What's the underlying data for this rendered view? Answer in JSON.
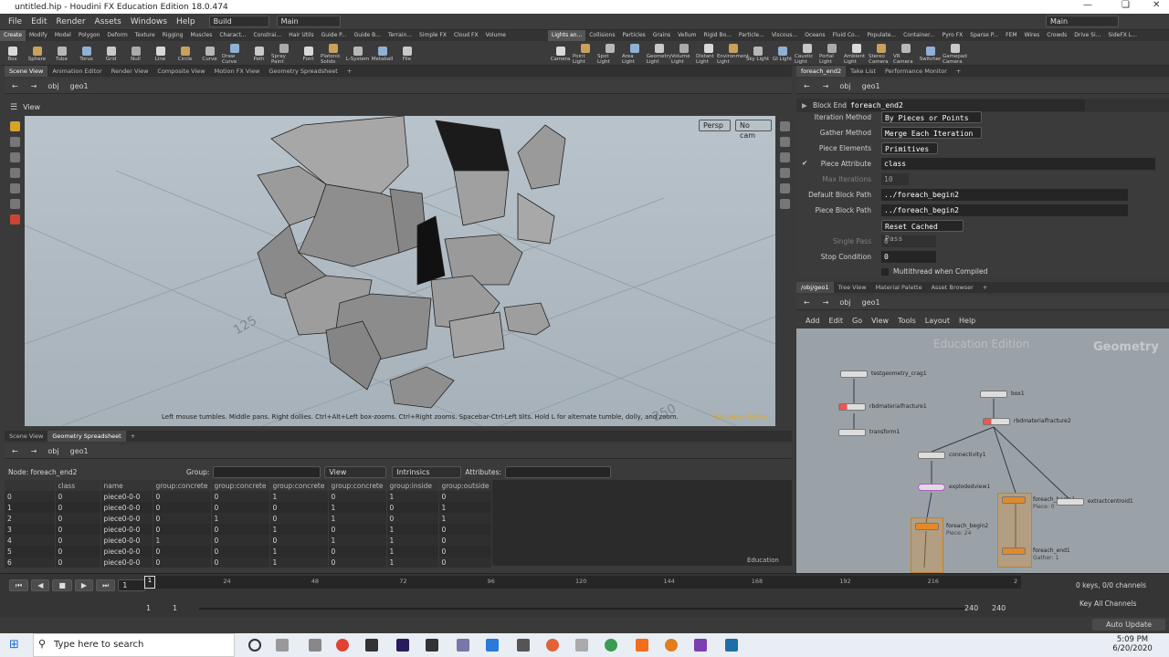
{
  "window": {
    "title": "untitled.hip - Houdini FX Education Edition 18.0.474"
  },
  "menubar": {
    "items": [
      "File",
      "Edit",
      "Render",
      "Assets",
      "Windows",
      "Help"
    ],
    "desktop": "Build",
    "context": "Main",
    "right_context": "Main"
  },
  "shelf_tabs_left": [
    "Create",
    "Modify",
    "Model",
    "Polygon",
    "Deform",
    "Texture",
    "Rigging",
    "Muscles",
    "Charact...",
    "Constrai...",
    "Hair Utils",
    "Guide P...",
    "Guide B...",
    "Terrain...",
    "Simple FX",
    "Cloud FX",
    "Volume"
  ],
  "shelf_tabs_right": [
    "Lights an...",
    "Collisions",
    "Particles",
    "Grains",
    "Vellum",
    "Rigid Bo...",
    "Particle...",
    "Viscous...",
    "Oceans",
    "Fluid Co...",
    "Populate...",
    "Container...",
    "Pyro FX",
    "Sparse P...",
    "FEM",
    "Wires",
    "Crowds",
    "Drive Si...",
    "SideFX L..."
  ],
  "tools_left": [
    "Box",
    "Sphere",
    "Tube",
    "Torus",
    "Grid",
    "Null",
    "Line",
    "Circle",
    "Curve",
    "Draw Curve",
    "Path",
    "Spray Paint",
    "Font",
    "Platonic Solids",
    "L-System",
    "Metaball",
    "File"
  ],
  "tools_right": [
    "Camera",
    "Point Light",
    "Spot Light",
    "Area Light",
    "Geometry Light",
    "Volume Light",
    "Distant Light",
    "Environment Light",
    "Sky Light",
    "GI Light",
    "Caustic Light",
    "Portal Light",
    "Ambient Light",
    "Stereo Camera",
    "VR Camera",
    "Switcher",
    "Gamepad Camera"
  ],
  "scene_tabs": [
    "Scene View",
    "Animation Editor",
    "Render View",
    "Composite View",
    "Motion FX View",
    "Geometry Spreadsheet"
  ],
  "scene_path": {
    "root": "obj",
    "node": "geo1"
  },
  "viewport": {
    "label": "View",
    "persp": "Persp",
    "cam": "No cam",
    "hint": "Left mouse tumbles. Middle pans. Right dollies. Ctrl+Alt+Left box-zooms. Ctrl+Right zooms. Spacebar-Ctrl-Left tilts. Hold L for alternate tumble, dolly, and zoom.",
    "watermark": "Education Edition",
    "grid_label_a": "125",
    "grid_label_b": "250"
  },
  "param_tabs": [
    "foreach_end2",
    "Take List",
    "Performance Monitor"
  ],
  "param_path": {
    "root": "obj",
    "node": "geo1"
  },
  "params": {
    "node_type": "Block End",
    "node_name": "foreach_end2",
    "iteration_method": {
      "label": "Iteration Method",
      "value": "By Pieces or Points"
    },
    "gather_method": {
      "label": "Gather Method",
      "value": "Merge Each Iteration"
    },
    "piece_elements": {
      "label": "Piece Elements",
      "value": "Primitives"
    },
    "piece_attribute": {
      "label": "Piece Attribute",
      "value": "class"
    },
    "max_iterations": {
      "label": "Max Iterations",
      "value": "10"
    },
    "default_block_path": {
      "label": "Default Block Path",
      "value": "../foreach_begin2"
    },
    "piece_block_path": {
      "label": "Piece Block Path",
      "value": "../foreach_begin2"
    },
    "reset_button": "Reset Cached Pass",
    "single_pass": {
      "label": "Single Pass",
      "value": "0"
    },
    "stop_condition": {
      "label": "Stop Condition",
      "value": "0"
    },
    "multithread": "Multithread when Compiled"
  },
  "net_tabs": [
    "/obj/geo1",
    "Tree View",
    "Material Palette",
    "Asset Browser"
  ],
  "net_path": {
    "root": "obj",
    "node": "geo1"
  },
  "net_menu": [
    "Add",
    "Edit",
    "Go",
    "View",
    "Tools",
    "Layout",
    "Help"
  ],
  "network": {
    "watermark": "Education Edition",
    "context": "Geometry",
    "nodes": [
      {
        "id": "testgeometry",
        "label": "testgeometry_crag1",
        "sub": ""
      },
      {
        "id": "rbd1",
        "label": "rbdmaterialfracture1",
        "sub": ""
      },
      {
        "id": "transform",
        "label": "transform1",
        "sub": ""
      },
      {
        "id": "box",
        "label": "box1",
        "sub": ""
      },
      {
        "id": "rbd2",
        "label": "rbdmaterialfracture2",
        "sub": ""
      },
      {
        "id": "connectivity",
        "label": "connectivity1",
        "sub": ""
      },
      {
        "id": "exploded",
        "label": "explodedview1",
        "sub": ""
      },
      {
        "id": "begin2",
        "label": "foreach_begin2",
        "sub": "Piece: 24"
      },
      {
        "id": "begin1",
        "label": "foreach_begin1",
        "sub": "Piece: 0"
      },
      {
        "id": "centroid",
        "label": "extractcentroid1",
        "sub": ""
      },
      {
        "id": "end1",
        "label": "foreach_end1",
        "sub": "Gather: 1"
      }
    ]
  },
  "spreadsheet": {
    "tabs": [
      "Scene View",
      "Geometry Spreadsheet"
    ],
    "path": {
      "root": "obj",
      "node": "geo1"
    },
    "node_label": "Node: foreach_end2",
    "group_label": "Group:",
    "view": "View",
    "intrinsics": "Intrinsics",
    "attributes_label": "Attributes:",
    "watermark": "Education",
    "columns": [
      "",
      "class",
      "name",
      "group:concrete",
      "group:concrete",
      "group:concrete",
      "group:concrete",
      "group:inside",
      "group:outside"
    ],
    "rows": [
      [
        "0",
        "0",
        "piece0-0-0",
        "0",
        "0",
        "1",
        "0",
        "1",
        "0"
      ],
      [
        "1",
        "0",
        "piece0-0-0",
        "0",
        "0",
        "0",
        "1",
        "0",
        "1"
      ],
      [
        "2",
        "0",
        "piece0-0-0",
        "0",
        "1",
        "0",
        "1",
        "0",
        "1"
      ],
      [
        "3",
        "0",
        "piece0-0-0",
        "0",
        "0",
        "1",
        "0",
        "1",
        "0"
      ],
      [
        "4",
        "0",
        "piece0-0-0",
        "1",
        "0",
        "0",
        "1",
        "1",
        "0"
      ],
      [
        "5",
        "0",
        "piece0-0-0",
        "0",
        "0",
        "1",
        "0",
        "1",
        "0"
      ],
      [
        "6",
        "0",
        "piece0-0-0",
        "0",
        "0",
        "1",
        "0",
        "1",
        "0"
      ]
    ]
  },
  "timeline": {
    "ticks": [
      "24",
      "48",
      "72",
      "96",
      "120",
      "144",
      "168",
      "192",
      "216",
      "2"
    ],
    "current_frame": "1",
    "start": "1",
    "start2": "1",
    "end": "240",
    "end2": "240",
    "keys": "0 keys, 0/0 channels",
    "channels": "Key All Channels",
    "auto_update": "Auto Update"
  },
  "taskbar": {
    "search": "Type here to search",
    "time": "5:09 PM",
    "date": "6/20/2020"
  }
}
